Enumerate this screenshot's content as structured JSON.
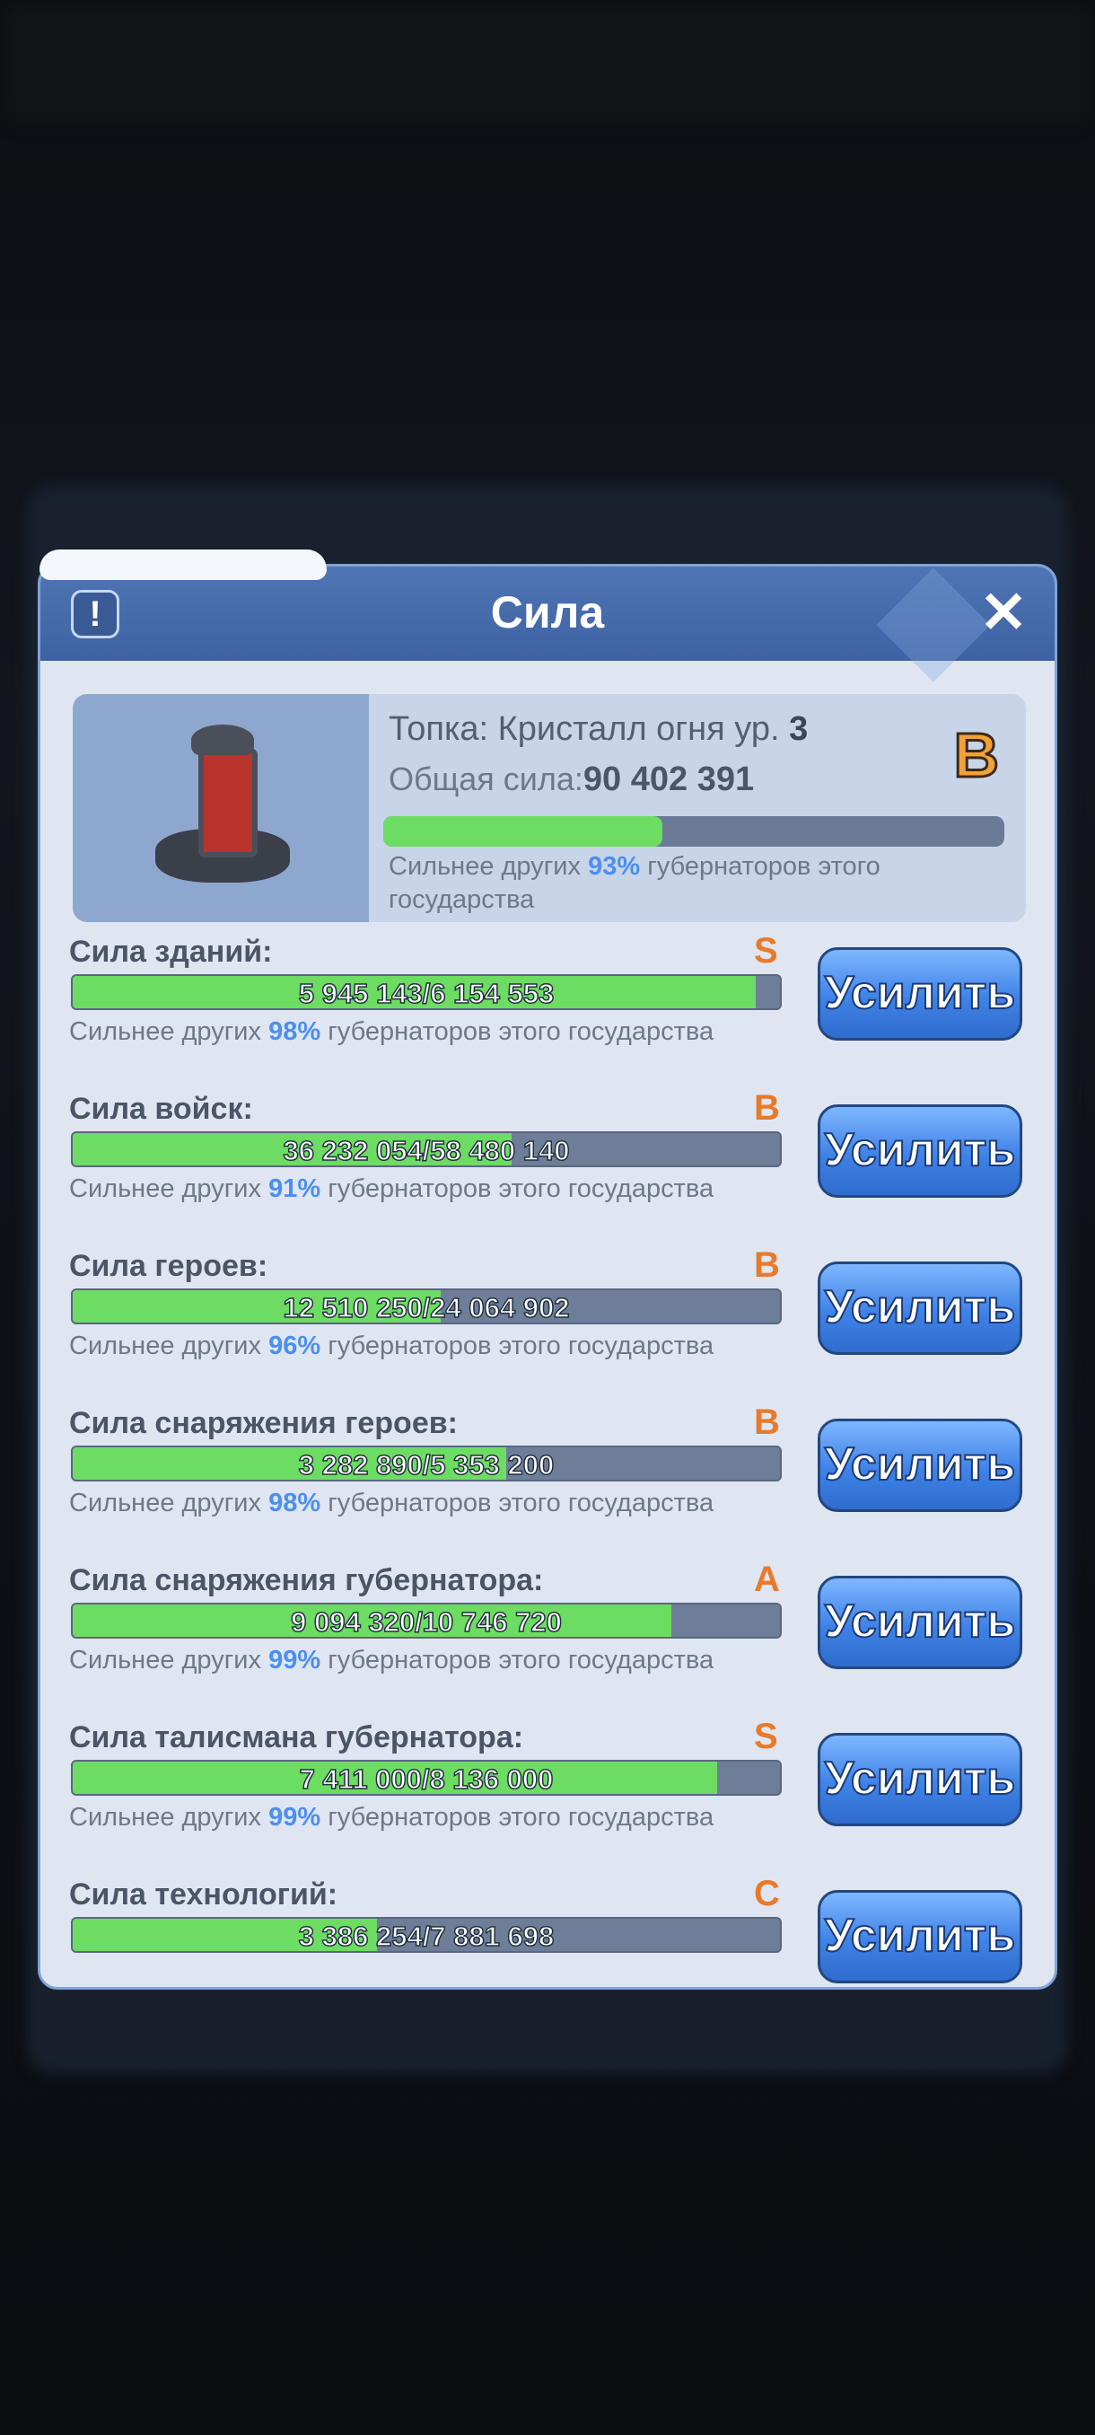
{
  "dialog": {
    "title": "Сила",
    "info_icon": "exclamation-icon",
    "close_icon": "close-icon"
  },
  "summary": {
    "title_prefix": "Топка: Кристалл огня ур.",
    "level": "3",
    "total_label": "Общая сила:",
    "total_value": "90 402 391",
    "grade": "B",
    "progress": 0.45,
    "note_before": "Сильнее других",
    "percent": "93%",
    "note_after": "губернаторов этого государства"
  },
  "button_label": "Усилить",
  "rows": [
    {
      "label": "Сила зданий:",
      "grade": "S",
      "value": "5 945 143/6 154 553",
      "progress": 0.966,
      "note_before": "Сильнее других",
      "percent": "98%",
      "note_after": "губернаторов этого государства"
    },
    {
      "label": "Сила войск:",
      "grade": "B",
      "value": "36 232 054/58 480 140",
      "progress": 0.62,
      "note_before": "Сильнее других",
      "percent": "91%",
      "note_after": "губернаторов этого государства"
    },
    {
      "label": "Сила героев:",
      "grade": "B",
      "value": "12 510 250/24 064 902",
      "progress": 0.52,
      "note_before": "Сильнее других",
      "percent": "96%",
      "note_after": "губернаторов этого государства"
    },
    {
      "label": "Сила снаряжения героев:",
      "grade": "B",
      "value": "3 282 890/5 353 200",
      "progress": 0.613,
      "note_before": "Сильнее других",
      "percent": "98%",
      "note_after": "губернаторов этого государства"
    },
    {
      "label": "Сила снаряжения губернатора:",
      "grade": "A",
      "value": "9 094 320/10 746 720",
      "progress": 0.846,
      "note_before": "Сильнее других",
      "percent": "99%",
      "note_after": "губернаторов этого государства"
    },
    {
      "label": "Сила талисмана губернатора:",
      "grade": "S",
      "value": "7 411 000/8 136 000",
      "progress": 0.911,
      "note_before": "Сильнее других",
      "percent": "99%",
      "note_after": "губернаторов этого государства"
    },
    {
      "label": "Сила технологий:",
      "grade": "C",
      "value": "3 386 254/7 881 698",
      "progress": 0.43
    }
  ]
}
